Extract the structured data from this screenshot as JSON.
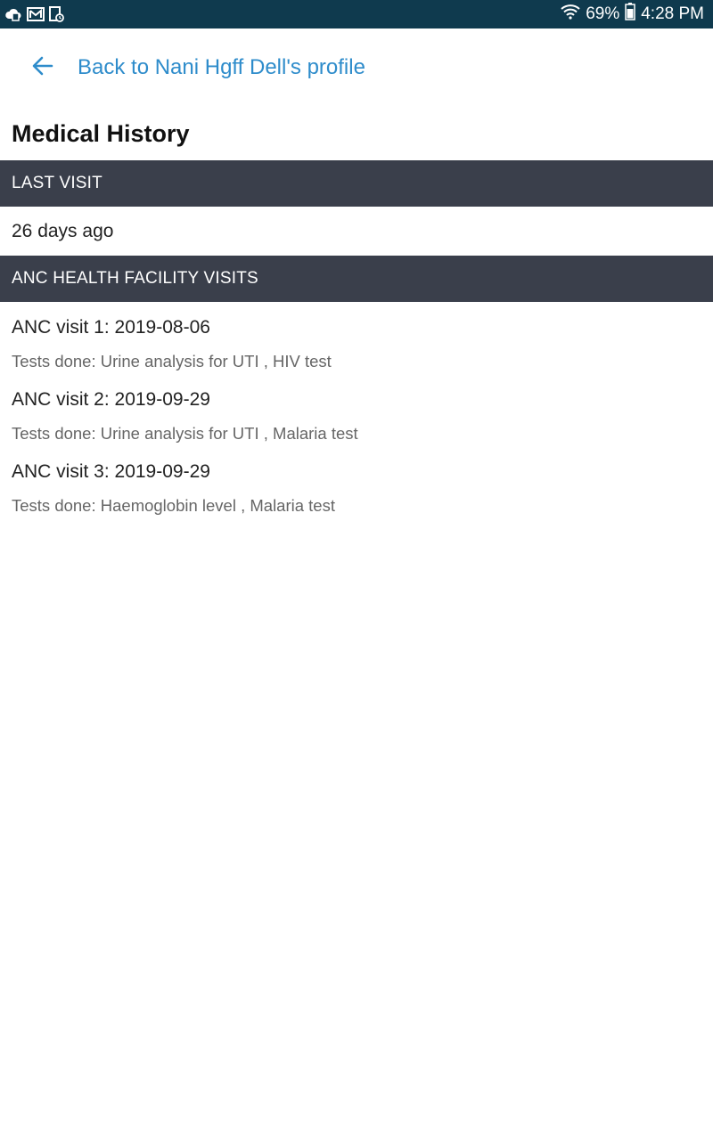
{
  "status_bar": {
    "notification_icons": [
      "cloud-icon",
      "mail-icon",
      "clipboard-icon"
    ],
    "wifi_icon": "wifi-icon",
    "battery_percent": "69%",
    "battery_icon": "battery-icon",
    "time": "4:28 PM"
  },
  "nav": {
    "back_icon": "arrow-left-icon",
    "back_label": "Back to Nani Hgff Dell's profile"
  },
  "page": {
    "title": "Medical History"
  },
  "sections": {
    "last_visit": {
      "header": "LAST VISIT",
      "value": "26 days ago"
    },
    "anc_visits": {
      "header": "ANC HEALTH FACILITY VISITS",
      "visits": [
        {
          "title": "ANC visit 1: 2019-08-06",
          "tests": "Tests done: Urine analysis for UTI , HIV test"
        },
        {
          "title": "ANC visit 2: 2019-09-29",
          "tests": "Tests done: Urine analysis for UTI , Malaria test"
        },
        {
          "title": "ANC visit 3: 2019-09-29",
          "tests": "Tests done: Haemoglobin level , Malaria test"
        }
      ]
    }
  },
  "colors": {
    "status_bar_bg": "#0f3a4e",
    "link_blue": "#2e8ccb",
    "section_header_bg": "#3a3f4b",
    "secondary_text": "#666666"
  }
}
